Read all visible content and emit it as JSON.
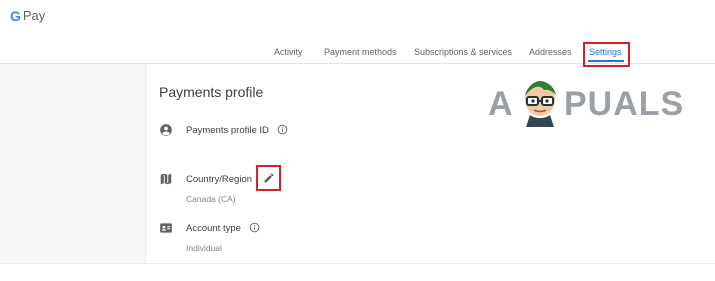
{
  "app": {
    "logo_g": "G",
    "logo_text": "Pay"
  },
  "nav": {
    "tabs": [
      {
        "label": "Activity"
      },
      {
        "label": "Payment methods"
      },
      {
        "label": "Subscriptions & services"
      },
      {
        "label": "Addresses"
      },
      {
        "label": "Settings",
        "selected": true
      }
    ]
  },
  "profile": {
    "title": "Payments profile",
    "items": [
      {
        "label": "Payments profile ID",
        "icon": "account-circle-icon",
        "info_icon": "info-icon"
      },
      {
        "label": "Country/Region",
        "value": "Canada (CA)",
        "icon": "map-icon",
        "action_icon": "pencil-icon"
      },
      {
        "label": "Account type",
        "value": "Individual",
        "icon": "contact-card-icon",
        "info_icon": "info-icon"
      }
    ]
  },
  "watermark": {
    "first": "A",
    "rest": "PUALS"
  },
  "colors": {
    "accent": "#1a73e8",
    "highlight": "#d32029",
    "text": "#3c4043",
    "muted": "#5f6368"
  }
}
